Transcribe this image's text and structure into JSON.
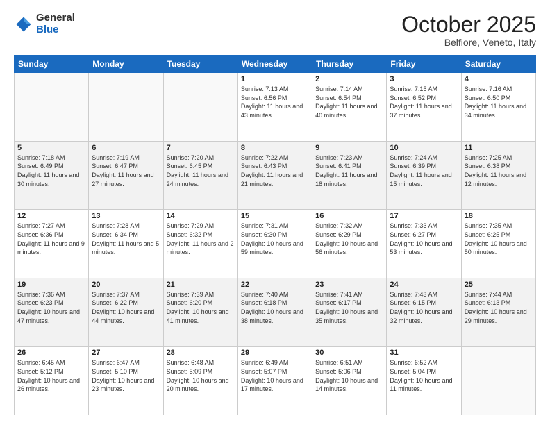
{
  "header": {
    "logo_general": "General",
    "logo_blue": "Blue",
    "month": "October 2025",
    "location": "Belfiore, Veneto, Italy"
  },
  "days_of_week": [
    "Sunday",
    "Monday",
    "Tuesday",
    "Wednesday",
    "Thursday",
    "Friday",
    "Saturday"
  ],
  "weeks": [
    [
      {
        "num": "",
        "info": ""
      },
      {
        "num": "",
        "info": ""
      },
      {
        "num": "",
        "info": ""
      },
      {
        "num": "1",
        "info": "Sunrise: 7:13 AM\nSunset: 6:56 PM\nDaylight: 11 hours and 43 minutes."
      },
      {
        "num": "2",
        "info": "Sunrise: 7:14 AM\nSunset: 6:54 PM\nDaylight: 11 hours and 40 minutes."
      },
      {
        "num": "3",
        "info": "Sunrise: 7:15 AM\nSunset: 6:52 PM\nDaylight: 11 hours and 37 minutes."
      },
      {
        "num": "4",
        "info": "Sunrise: 7:16 AM\nSunset: 6:50 PM\nDaylight: 11 hours and 34 minutes."
      }
    ],
    [
      {
        "num": "5",
        "info": "Sunrise: 7:18 AM\nSunset: 6:49 PM\nDaylight: 11 hours and 30 minutes."
      },
      {
        "num": "6",
        "info": "Sunrise: 7:19 AM\nSunset: 6:47 PM\nDaylight: 11 hours and 27 minutes."
      },
      {
        "num": "7",
        "info": "Sunrise: 7:20 AM\nSunset: 6:45 PM\nDaylight: 11 hours and 24 minutes."
      },
      {
        "num": "8",
        "info": "Sunrise: 7:22 AM\nSunset: 6:43 PM\nDaylight: 11 hours and 21 minutes."
      },
      {
        "num": "9",
        "info": "Sunrise: 7:23 AM\nSunset: 6:41 PM\nDaylight: 11 hours and 18 minutes."
      },
      {
        "num": "10",
        "info": "Sunrise: 7:24 AM\nSunset: 6:39 PM\nDaylight: 11 hours and 15 minutes."
      },
      {
        "num": "11",
        "info": "Sunrise: 7:25 AM\nSunset: 6:38 PM\nDaylight: 11 hours and 12 minutes."
      }
    ],
    [
      {
        "num": "12",
        "info": "Sunrise: 7:27 AM\nSunset: 6:36 PM\nDaylight: 11 hours and 9 minutes."
      },
      {
        "num": "13",
        "info": "Sunrise: 7:28 AM\nSunset: 6:34 PM\nDaylight: 11 hours and 5 minutes."
      },
      {
        "num": "14",
        "info": "Sunrise: 7:29 AM\nSunset: 6:32 PM\nDaylight: 11 hours and 2 minutes."
      },
      {
        "num": "15",
        "info": "Sunrise: 7:31 AM\nSunset: 6:30 PM\nDaylight: 10 hours and 59 minutes."
      },
      {
        "num": "16",
        "info": "Sunrise: 7:32 AM\nSunset: 6:29 PM\nDaylight: 10 hours and 56 minutes."
      },
      {
        "num": "17",
        "info": "Sunrise: 7:33 AM\nSunset: 6:27 PM\nDaylight: 10 hours and 53 minutes."
      },
      {
        "num": "18",
        "info": "Sunrise: 7:35 AM\nSunset: 6:25 PM\nDaylight: 10 hours and 50 minutes."
      }
    ],
    [
      {
        "num": "19",
        "info": "Sunrise: 7:36 AM\nSunset: 6:23 PM\nDaylight: 10 hours and 47 minutes."
      },
      {
        "num": "20",
        "info": "Sunrise: 7:37 AM\nSunset: 6:22 PM\nDaylight: 10 hours and 44 minutes."
      },
      {
        "num": "21",
        "info": "Sunrise: 7:39 AM\nSunset: 6:20 PM\nDaylight: 10 hours and 41 minutes."
      },
      {
        "num": "22",
        "info": "Sunrise: 7:40 AM\nSunset: 6:18 PM\nDaylight: 10 hours and 38 minutes."
      },
      {
        "num": "23",
        "info": "Sunrise: 7:41 AM\nSunset: 6:17 PM\nDaylight: 10 hours and 35 minutes."
      },
      {
        "num": "24",
        "info": "Sunrise: 7:43 AM\nSunset: 6:15 PM\nDaylight: 10 hours and 32 minutes."
      },
      {
        "num": "25",
        "info": "Sunrise: 7:44 AM\nSunset: 6:13 PM\nDaylight: 10 hours and 29 minutes."
      }
    ],
    [
      {
        "num": "26",
        "info": "Sunrise: 6:45 AM\nSunset: 5:12 PM\nDaylight: 10 hours and 26 minutes."
      },
      {
        "num": "27",
        "info": "Sunrise: 6:47 AM\nSunset: 5:10 PM\nDaylight: 10 hours and 23 minutes."
      },
      {
        "num": "28",
        "info": "Sunrise: 6:48 AM\nSunset: 5:09 PM\nDaylight: 10 hours and 20 minutes."
      },
      {
        "num": "29",
        "info": "Sunrise: 6:49 AM\nSunset: 5:07 PM\nDaylight: 10 hours and 17 minutes."
      },
      {
        "num": "30",
        "info": "Sunrise: 6:51 AM\nSunset: 5:06 PM\nDaylight: 10 hours and 14 minutes."
      },
      {
        "num": "31",
        "info": "Sunrise: 6:52 AM\nSunset: 5:04 PM\nDaylight: 10 hours and 11 minutes."
      },
      {
        "num": "",
        "info": ""
      }
    ]
  ]
}
